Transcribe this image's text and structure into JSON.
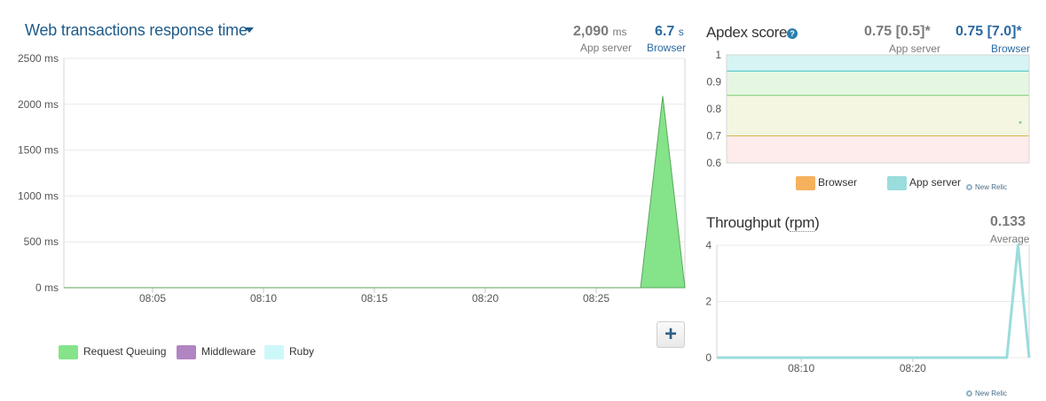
{
  "response_time": {
    "title": "Web transactions response time",
    "app_server_value": "2,090",
    "app_server_unit": "ms",
    "app_server_label": "App server",
    "browser_value": "6.7",
    "browser_unit": "s",
    "browser_label": "Browser",
    "add_button": "+",
    "legend": [
      {
        "label": "Request Queuing",
        "color": "#85e38a"
      },
      {
        "label": "Middleware",
        "color": "#b085c2"
      },
      {
        "label": "Ruby",
        "color": "#cdf8fa"
      }
    ]
  },
  "apdex": {
    "title": "Apdex score",
    "help": "?",
    "app_server_value": "0.75 [0.5]*",
    "app_server_label": "App server",
    "browser_value": "0.75 [7.0]*",
    "browser_label": "Browser",
    "legend": [
      {
        "label": "Browser",
        "color": "#f6b15f"
      },
      {
        "label": "App server",
        "color": "#9bdcdc"
      }
    ],
    "branding": "New Relic"
  },
  "throughput": {
    "title_prefix": "Throughput (",
    "title_unit": "rpm",
    "title_suffix": ")",
    "value": "0.133",
    "value_label": "Average",
    "branding": "New Relic"
  },
  "colors": {
    "accent_blue": "#2a6aa3",
    "request_queuing": "#85e38a",
    "throughput_line": "#9bdcdc"
  },
  "chart_data": [
    {
      "type": "area",
      "x_ticks": [
        "08:05",
        "08:10",
        "08:15",
        "08:20",
        "08:25"
      ],
      "y_ticks": [
        "2500 ms",
        "2000 ms",
        "1500 ms",
        "1000 ms",
        "500 ms",
        "0 ms"
      ],
      "ylim": [
        0,
        2500
      ],
      "grid": true,
      "series": [
        {
          "name": "Request Queuing",
          "color": "#85e38a",
          "points": [
            [
              "08:01",
              0
            ],
            [
              "08:27",
              0
            ],
            [
              "08:28",
              2090
            ],
            [
              "08:29",
              0
            ]
          ]
        }
      ]
    },
    {
      "type": "line",
      "y_ticks": [
        "1",
        "0.9",
        "0.8",
        "0.7",
        "0.6"
      ],
      "ylim": [
        0.6,
        1.0
      ],
      "bands": [
        {
          "from": 0.94,
          "to": 1.0,
          "color": "#d7f4f4"
        },
        {
          "from": 0.85,
          "to": 0.94,
          "color": "#e5f7e2"
        },
        {
          "from": 0.7,
          "to": 0.85,
          "color": "#f5f6e1"
        },
        {
          "from": 0.6,
          "to": 0.7,
          "color": "#fdeceb"
        }
      ],
      "thresholds": [
        {
          "value": 0.94,
          "color": "#3cbfbf"
        },
        {
          "value": 0.85,
          "color": "#79c96f"
        },
        {
          "value": 0.7,
          "color": "#d3b34a"
        }
      ],
      "series": [
        {
          "name": "App server",
          "color": "#9bdcdc",
          "points": [
            [
              "08:29",
              0.75
            ]
          ]
        }
      ]
    },
    {
      "type": "line",
      "x_ticks": [
        "08:10",
        "08:20"
      ],
      "y_ticks": [
        "4",
        "2",
        "0"
      ],
      "ylim": [
        0,
        4
      ],
      "grid": true,
      "series": [
        {
          "name": "Throughput",
          "color": "#9bdcdc",
          "points": [
            [
              "08:01",
              0
            ],
            [
              "08:27",
              0
            ],
            [
              "08:28",
              4
            ],
            [
              "08:29",
              0
            ]
          ]
        }
      ]
    }
  ]
}
